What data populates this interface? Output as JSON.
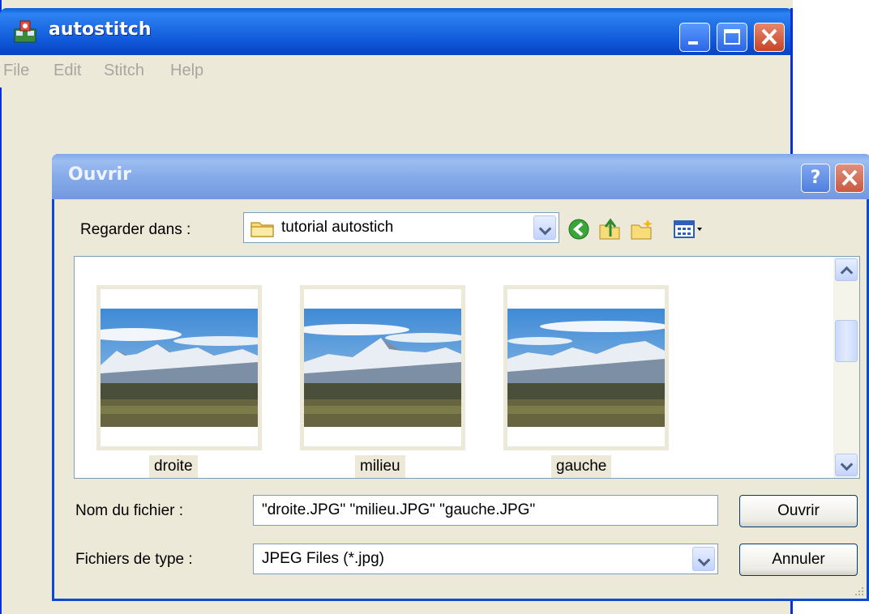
{
  "main_window": {
    "title": "autostitch",
    "menu": [
      "File",
      "Edit",
      "Stitch",
      "Help"
    ]
  },
  "dialog": {
    "title": "Ouvrir",
    "help_label": "?",
    "look_in_label": "Regarder dans :",
    "look_in_value": "tutorial autostich",
    "files": [
      {
        "name": "droite"
      },
      {
        "name": "milieu"
      },
      {
        "name": "gauche"
      }
    ],
    "filename_label": "Nom du fichier :",
    "filename_value": "\"droite.JPG\" \"milieu.JPG\" \"gauche.JPG\"",
    "filetype_label": "Fichiers de type :",
    "filetype_value": "JPEG Files (*.jpg)",
    "open_button": "Ouvrir",
    "cancel_button": "Annuler"
  },
  "colors": {
    "xp_blue_title": "#0d55d6",
    "dialog_inactive_title": "#86abe9",
    "window_bg": "#ece9d8"
  }
}
